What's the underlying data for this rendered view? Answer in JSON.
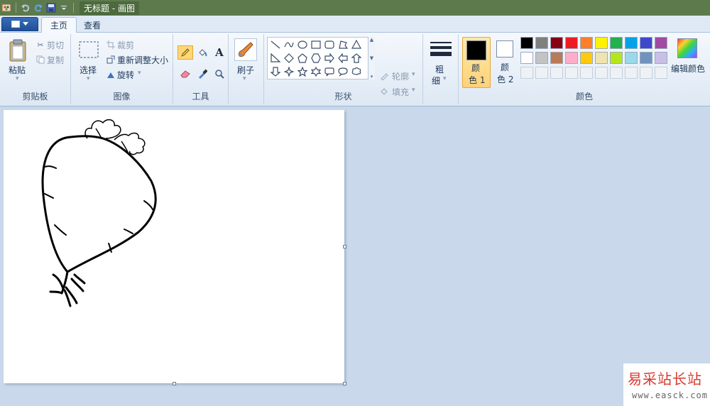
{
  "titlebar": {
    "title": "无标题 - 画图",
    "quick_access": [
      "paint-app-icon",
      "undo-icon",
      "redo-icon",
      "save-icon",
      "customize-dropdown-icon"
    ]
  },
  "tabs": [
    {
      "label": "主页",
      "active": true
    },
    {
      "label": "查看",
      "active": false
    }
  ],
  "ribbon": {
    "clipboard": {
      "group_label": "剪贴板",
      "paste": "粘贴",
      "cut": "剪切",
      "copy": "复制"
    },
    "image": {
      "group_label": "图像",
      "select": "选择",
      "crop": "裁剪",
      "resize": "重新调整大小",
      "rotate": "旋转"
    },
    "tools": {
      "group_label": "工具",
      "items": [
        "pencil-icon",
        "fill-icon",
        "text-icon",
        "eraser-icon",
        "color-picker-icon",
        "magnifier-icon"
      ],
      "text_glyph": "A"
    },
    "brushes": {
      "label": "刷子"
    },
    "shapes": {
      "group_label": "形状",
      "outline": "轮廓",
      "fill": "填充"
    },
    "size": {
      "label_1": "粗",
      "label_2": "细"
    },
    "colors": {
      "group_label": "颜色",
      "color1_label_1": "颜",
      "color1_label_2": "色 1",
      "color2_label_1": "颜",
      "color2_label_2": "色 2",
      "color1_value": "#000000",
      "color2_value": "#ffffff",
      "edit_colors": "编辑颜色",
      "palette_row1": [
        "#000000",
        "#7f7f7f",
        "#880015",
        "#ed1c24",
        "#ff7f27",
        "#fff200",
        "#22b14c",
        "#00a2e8",
        "#3f48cc",
        "#a349a4"
      ],
      "palette_row2": [
        "#ffffff",
        "#c3c3c3",
        "#b97a57",
        "#ffaec9",
        "#ffc90e",
        "#efe4b0",
        "#b5e61d",
        "#99d9ea",
        "#7092be",
        "#c8bfe7"
      ],
      "palette_row3": [
        "",
        "",
        "",
        "",
        "",
        "",
        "",
        "",
        "",
        ""
      ]
    }
  },
  "canvas": {
    "drawing": "radish-sketch",
    "background": "#ffffff"
  },
  "watermark": {
    "title": "易采站长站",
    "url": "www.easck.com"
  }
}
